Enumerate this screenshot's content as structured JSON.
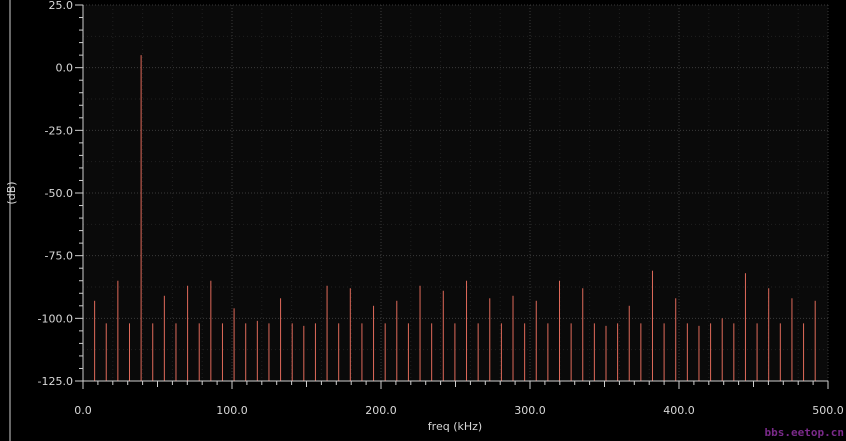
{
  "chart_data": {
    "type": "bar",
    "title": "",
    "xlabel": "freq (kHz)",
    "ylabel": "(dB)",
    "xlim": [
      0,
      500
    ],
    "ylim": [
      -125,
      25
    ],
    "xticks": [
      "0.0",
      "100.0",
      "200.0",
      "300.0",
      "400.0",
      "500.0"
    ],
    "yticks": [
      "25.0",
      "0.0",
      "-25.0",
      "-50.0",
      "-75.0",
      "-100.0",
      "-125.0"
    ],
    "grid": true,
    "colors": {
      "background": "#0a0a0a",
      "grid": "#3a3a3a",
      "bar": "#e06a5a",
      "axis": "#cfcfcf"
    },
    "series": [
      {
        "x": [
          0,
          7.8,
          15.6,
          23.4,
          31.2,
          39,
          46.8,
          54.6,
          62.4,
          70.2,
          78,
          85.8,
          93.6,
          101.4,
          109.2,
          117,
          124.8,
          132.6,
          140.4,
          148.2,
          156,
          163.8,
          171.6,
          179.4,
          187.2,
          195,
          202.8,
          210.6,
          218.4,
          226.2,
          234,
          241.8,
          249.6,
          257.4,
          265.2,
          273,
          280.8,
          288.6,
          296.4,
          304.2,
          312,
          319.8,
          327.6,
          335.4,
          343.2,
          351,
          358.8,
          366.6,
          374.4,
          382.2,
          390,
          397.8,
          405.6,
          413.4,
          421.2,
          429,
          436.8,
          444.6,
          452.4,
          460.2,
          468,
          475.8,
          483.6,
          491.4
        ],
        "values": [
          -72,
          -93,
          -102,
          -85,
          -102,
          5,
          -102,
          -91,
          -102,
          -87,
          -102,
          -85,
          -102,
          -96,
          -102,
          -101,
          -102,
          -92,
          -102,
          -103,
          -102,
          -87,
          -102,
          -88,
          -102,
          -95,
          -102,
          -93,
          -102,
          -87,
          -102,
          -89,
          -102,
          -85,
          -102,
          -92,
          -102,
          -91,
          -102,
          -93,
          -102,
          -85,
          -102,
          -88,
          -102,
          -103,
          -102,
          -95,
          -102,
          -81,
          -102,
          -92,
          -102,
          -103,
          -102,
          -100,
          -102,
          -82,
          -102,
          -88,
          -102,
          -92,
          -102,
          -93
        ]
      }
    ]
  },
  "watermark": "bbs.eetop.cn"
}
